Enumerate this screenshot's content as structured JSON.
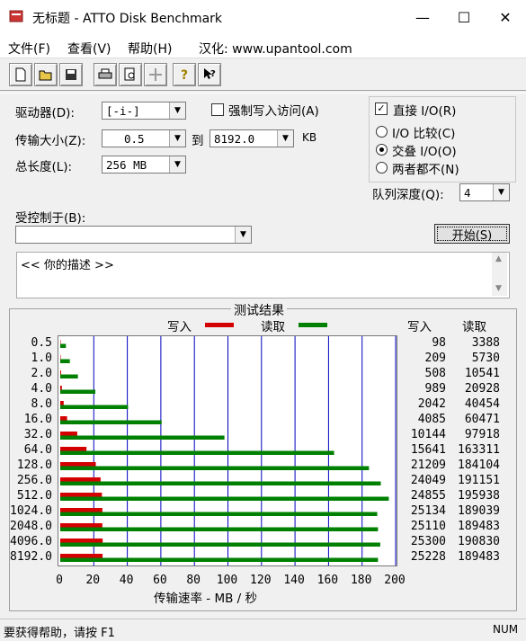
{
  "window": {
    "title": "无标题 - ATTO Disk Benchmark",
    "min": "—",
    "max": "☐",
    "close": "✕"
  },
  "menu": [
    "文件(F)",
    "查看(V)",
    "帮助(H)",
    "汉化: www.upantool.com"
  ],
  "toolbar": [
    "new",
    "open",
    "save",
    "print",
    "print-preview",
    "move",
    "help",
    "context-help"
  ],
  "form": {
    "drive_label": "驱动器(D):",
    "drive_value": "[-i-]",
    "force_write_label": "强制写入访问(A)",
    "force_write_checked": false,
    "transfer_label": "传输大小(Z):",
    "transfer_from": "0.5",
    "to_label": "到",
    "transfer_to": "8192.0",
    "unit": "KB",
    "total_label": "总长度(L):",
    "total_value": "256 MB",
    "direct_io_label": "直接 I/O(R)",
    "direct_io_checked": true,
    "io_compare": "I/O 比较(C)",
    "io_overlap": "交叠 I/O(O)",
    "io_neither": "两者都不(N)",
    "queue_label": "队列深度(Q):",
    "queue_value": "4",
    "controlled_label": "受控制于(B):",
    "controlled_value": "",
    "start_button": "开始(S)",
    "desc_text": "<<  你的描述  >>"
  },
  "results": {
    "title": "测试结果",
    "legend_write": "写入",
    "legend_read": "读取",
    "col_write": "写入",
    "col_read": "读取",
    "xlabel": "传输速率 - MB / 秒",
    "colors": {
      "write": "#d40000",
      "read": "#008000",
      "grid": "#0000c0"
    }
  },
  "chart_data": {
    "type": "bar",
    "orientation": "horizontal",
    "categories": [
      "0.5",
      "1.0",
      "2.0",
      "4.0",
      "8.0",
      "16.0",
      "32.0",
      "64.0",
      "128.0",
      "256.0",
      "512.0",
      "1024.0",
      "2048.0",
      "4096.0",
      "8192.0"
    ],
    "series": [
      {
        "name": "写入",
        "values": [
          98,
          209,
          508,
          989,
          2042,
          4085,
          10144,
          15641,
          21209,
          24049,
          24855,
          25134,
          25110,
          25300,
          25228
        ]
      },
      {
        "name": "读取",
        "values": [
          3388,
          5730,
          10541,
          20928,
          40454,
          60471,
          97918,
          163311,
          184104,
          191151,
          195938,
          189039,
          189483,
          190830,
          189483
        ]
      }
    ],
    "xticks": [
      "0",
      "20",
      "40",
      "60",
      "80",
      "100",
      "120",
      "140",
      "160",
      "180",
      "200"
    ],
    "xlim": [
      0,
      200
    ],
    "xlabel": "传输速率 - MB / 秒"
  },
  "status": "要获得帮助，请按 F1",
  "statusbar_right": "NUM"
}
